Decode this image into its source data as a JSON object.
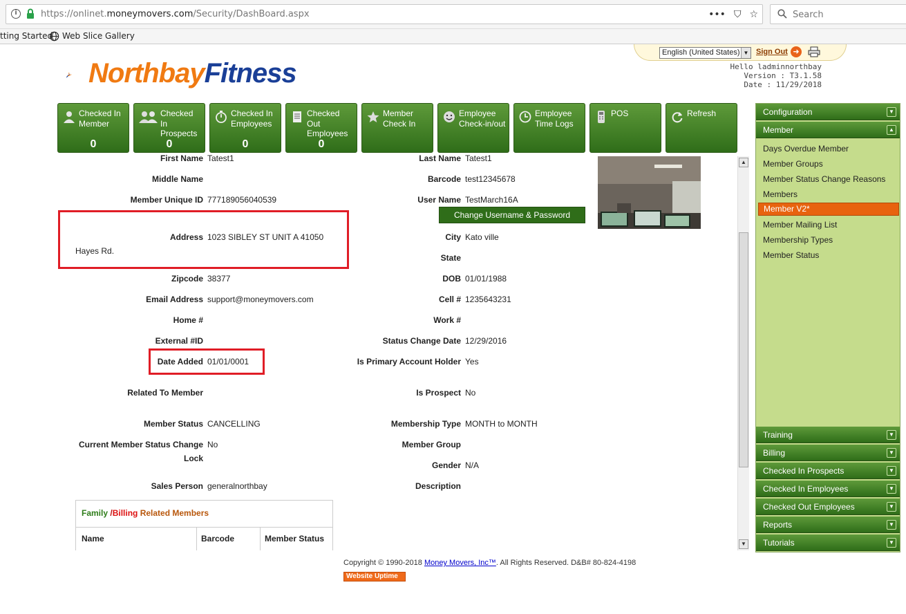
{
  "browser": {
    "url_prefix": "https://onlinet.",
    "url_host": "moneymovers.com",
    "url_path": "/Security/DashBoard.aspx",
    "search_placeholder": "Search",
    "actions": [
      "•••",
      "⛉",
      "☆"
    ]
  },
  "bookmarks": [
    "tting Started",
    "Web Slice Gallery"
  ],
  "header": {
    "logo_north": "Northbay",
    "logo_fitness": "Fitness",
    "language": "English (United States)",
    "sign_out": "Sign Out",
    "greeting": "Hello ladminnorthbay",
    "version": "Version : T3.1.58",
    "date": "Date : 11/29/2018"
  },
  "tiles": [
    {
      "label": "Checked In Member",
      "count": "0",
      "icon": "person-icon"
    },
    {
      "label": "Checked In Prospects",
      "count": "0",
      "icon": "people-icon"
    },
    {
      "label": "Checked In Employees",
      "count": "0",
      "icon": "stopwatch-icon"
    },
    {
      "label": "Checked Out Employees",
      "count": "0",
      "icon": "receipt-icon"
    },
    {
      "label": "Member Check In",
      "count": "",
      "icon": "star-icon"
    },
    {
      "label": "Employee Check-in/out",
      "count": "",
      "icon": "smiley-icon"
    },
    {
      "label": "Employee Time Logs",
      "count": "",
      "icon": "clock-icon"
    },
    {
      "label": "POS",
      "count": "",
      "icon": "pos-icon"
    },
    {
      "label": "Refresh",
      "count": "",
      "icon": "refresh-icon"
    }
  ],
  "member": {
    "first_name_label": "First Name",
    "first_name": "Tatest1",
    "last_name_label": "Last Name",
    "last_name": "Tatest1",
    "middle_name_label": "Middle Name",
    "middle_name": "",
    "barcode_label": "Barcode",
    "barcode": "test12345678",
    "unique_id_label": "Member Unique ID",
    "unique_id": "777189056040539",
    "user_name_label": "User Name",
    "user_name": "TestMarch16A",
    "change_button": "Change Username & Password",
    "address_label": "Address",
    "address_line1": "1023 SIBLEY ST UNIT A 41050",
    "address_line2": "Hayes Rd.",
    "city_label": "City",
    "city": "Kato ville",
    "state_label": "State",
    "state": "",
    "zipcode_label": "Zipcode",
    "zipcode": "38377",
    "dob_label": "DOB",
    "dob": "01/01/1988",
    "email_label": "Email Address",
    "email": "support@moneymovers.com",
    "cell_label": "Cell #",
    "cell": "1235643231",
    "home_label": "Home #",
    "home": "",
    "work_label": "Work #",
    "work": "",
    "external_label": "External #ID",
    "external": "",
    "status_change_label": "Status Change Date",
    "status_change": "12/29/2016",
    "date_added_label": "Date Added",
    "date_added": "01/01/0001",
    "primary_label": "Is Primary Account Holder",
    "primary": "Yes",
    "related_label": "Related To Member",
    "related": "",
    "prospect_label": "Is Prospect",
    "prospect": "No",
    "status_label": "Member Status",
    "status": "CANCELLING",
    "membership_type_label": "Membership Type",
    "membership_type": "MONTH to MONTH",
    "lock_label_line1": "Current Member Status Change",
    "lock_label_line2": "Lock",
    "lock": "No",
    "group_label": "Member Group",
    "group": "",
    "gender_label": "Gender",
    "gender": "N/A",
    "sales_label": "Sales Person",
    "sales": "generalnorthbay",
    "description_label": "Description",
    "description": ""
  },
  "related_members": {
    "title_family": "Family",
    "title_slash": " /",
    "title_billing": "Billing",
    "title_rest": " Related Members",
    "columns": [
      "Name",
      "Barcode",
      "Member Status"
    ]
  },
  "sidebar": {
    "top_sections": [
      "Configuration",
      "Member"
    ],
    "member_items": [
      "Days Overdue Member",
      "Member Groups",
      "Member Status Change Reasons",
      "Members",
      "Member V2*",
      "Member Mailing List",
      "Membership Types",
      "Member Status"
    ],
    "active_item": "Member V2*",
    "bottom_sections": [
      "Training",
      "Billing",
      "Checked In Prospects",
      "Checked In Employees",
      "Checked Out Employees",
      "Reports",
      "Tutorials"
    ]
  },
  "footer": {
    "copyright": "Copyright © 1990-2018 ",
    "company": "Money Movers, Inc™",
    "rights": ".   All Rights Reserved.    D&B# 80-824-4198",
    "uptime": "Website Uptime"
  },
  "colors": {
    "brand_orange": "#f07a12",
    "brand_blue": "#1a3f97",
    "tile_green": "#2f6d19",
    "highlight_red": "#e01d26",
    "sidebar_green": "#c5dc8c"
  }
}
